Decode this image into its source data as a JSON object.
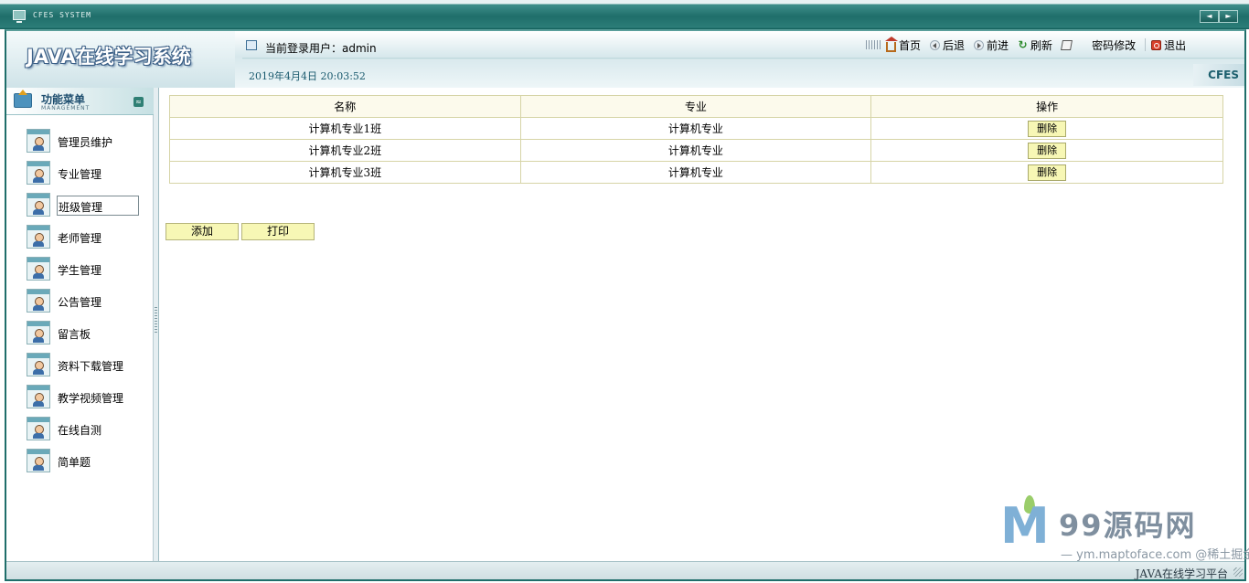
{
  "window": {
    "title": "CFES SYSTEM",
    "prev_label": "◄",
    "next_label": "►"
  },
  "header": {
    "brand": "JAVA在线学习系统",
    "user_label": "当前登录用户：admin",
    "datetime": "2019年4月4日  20:03:52",
    "badge": "CFES"
  },
  "topnav": {
    "items": [
      {
        "label": "首页",
        "icon": "home-icon"
      },
      {
        "label": "后退",
        "icon": "back-icon"
      },
      {
        "label": "前进",
        "icon": "forward-icon"
      },
      {
        "label": "刷新",
        "icon": "refresh-icon"
      },
      {
        "label": "密码修改",
        "icon": "password-edit-icon"
      },
      {
        "label": "退出",
        "icon": "exit-icon"
      }
    ]
  },
  "sidebar": {
    "title": "功能菜单",
    "subtitle": "MANAGEMENT",
    "collapse_label": "≈",
    "items": [
      {
        "label": "管理员维护"
      },
      {
        "label": "专业管理"
      },
      {
        "label": "班级管理"
      },
      {
        "label": "老师管理"
      },
      {
        "label": "学生管理"
      },
      {
        "label": "公告管理"
      },
      {
        "label": "留言板"
      },
      {
        "label": "资料下载管理"
      },
      {
        "label": "教学视频管理"
      },
      {
        "label": "在线自测"
      },
      {
        "label": "简单题"
      }
    ],
    "active_index": 2
  },
  "table": {
    "headers": [
      "名称",
      "专业",
      "操作"
    ],
    "rows": [
      {
        "name": "计算机专业1班",
        "major": "计算机专业",
        "action": "删除"
      },
      {
        "name": "计算机专业2班",
        "major": "计算机专业",
        "action": "删除"
      },
      {
        "name": "计算机专业3班",
        "major": "计算机专业",
        "action": "删除"
      }
    ]
  },
  "actions": {
    "add_label": "添加",
    "print_label": "打印"
  },
  "watermark": {
    "logo": "M",
    "title": "99源码网",
    "subtitle": "— ym.maptoface.com @稀土掘金技术社区"
  },
  "footer": {
    "text": "JAVA在线学习平台"
  },
  "colors": {
    "theme_dark": "#1f6e6a",
    "button_fill": "#f7f7b5",
    "table_border": "#d6d4a6"
  }
}
